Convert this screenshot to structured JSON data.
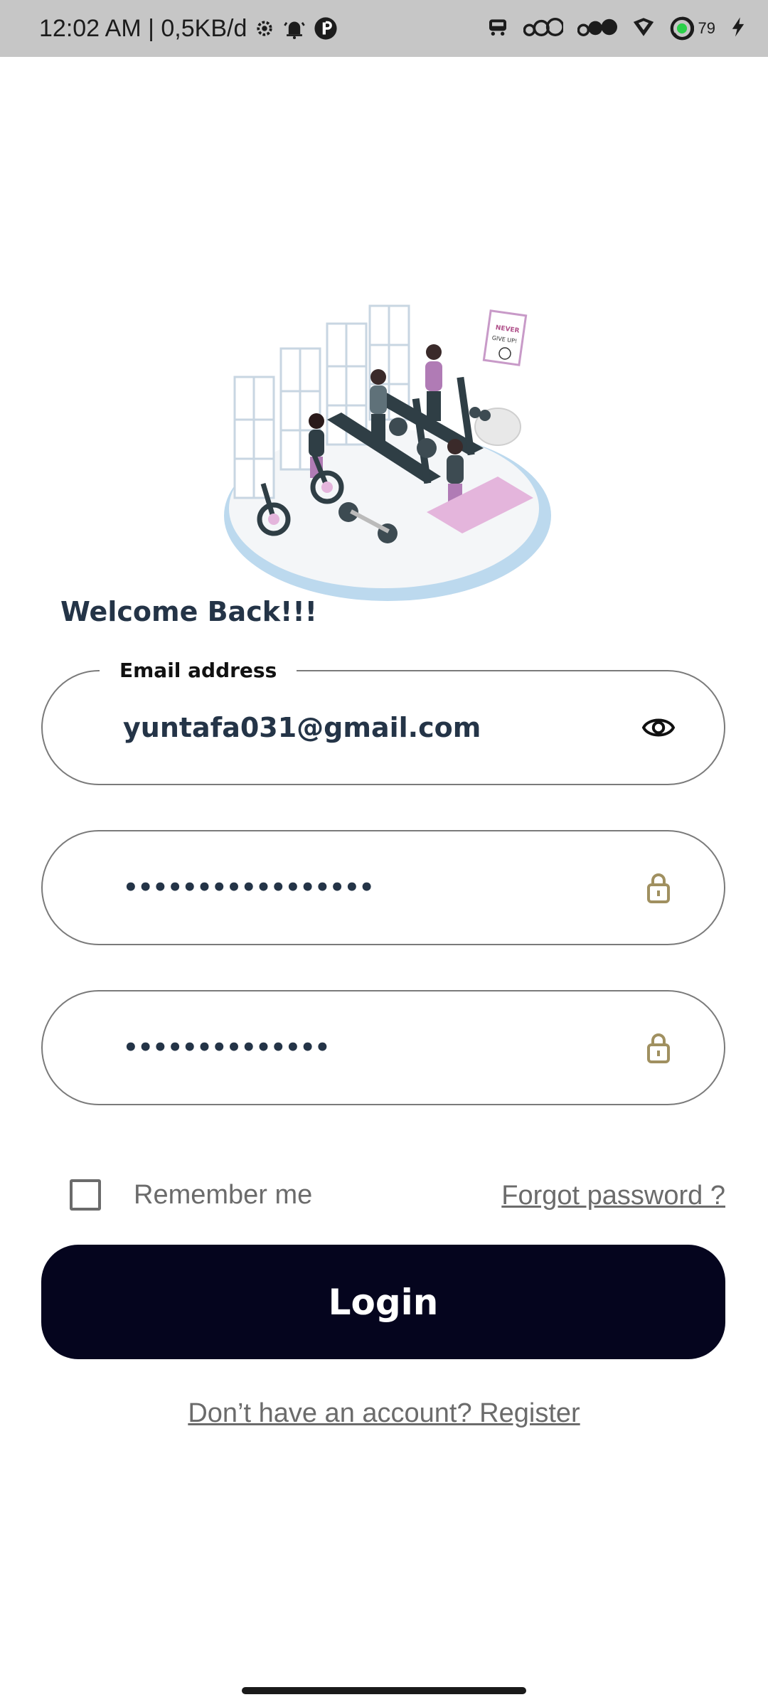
{
  "status_bar": {
    "time_info": "12:02 AM | 0,5KB/d",
    "battery_level": "79",
    "icons": [
      "settings-icon",
      "alarm-icon",
      "app-icon",
      "carrier-icon",
      "signal-icon",
      "signal-2-icon",
      "vpn-shield-icon",
      "battery-icon",
      "charging-icon"
    ]
  },
  "illustration": {
    "icon": "gym-illustration",
    "poster_text": [
      "NEVER",
      "GIVE UP!"
    ]
  },
  "login": {
    "welcome": "Welcome Back!!!",
    "email": {
      "label": "Email address",
      "value": "yuntafa031@gmail.com",
      "icon": "eye-icon"
    },
    "password": {
      "value": "•••••••••••••••••",
      "icon": "lock-icon"
    },
    "confirm_password": {
      "value": "••••••••••••••",
      "icon": "lock-icon"
    },
    "remember_me": {
      "label": "Remember me",
      "checked": false
    },
    "forgot_password": "Forgot password ?",
    "login_button": "Login",
    "register_link": "Don’t have an account? Register"
  },
  "colors": {
    "primary": "#05051e",
    "heading": "#243447",
    "lock_icon": "#a09060",
    "status_bar_bg": "#c6c6c6"
  }
}
